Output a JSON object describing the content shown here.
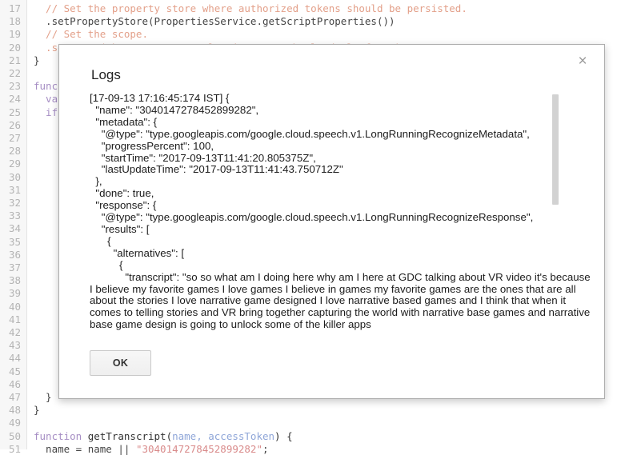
{
  "editor": {
    "first_line_number": 17,
    "lines": [
      {
        "n": 17,
        "segments": [
          {
            "t": "  // Set the property store where authorized tokens should be persisted.",
            "c": "tok-comment"
          }
        ]
      },
      {
        "n": 18,
        "segments": [
          {
            "t": "  .setPropertyStore(PropertiesService.getScriptProperties())",
            "c": "tok-plain"
          }
        ]
      },
      {
        "n": 19,
        "segments": [
          {
            "t": "  // Set the scope.",
            "c": "tok-comment"
          }
        ]
      },
      {
        "n": 20,
        "segments": [
          {
            "t": "  .setScope('https://www.googleapis.com/auth/cloud-platform');",
            "c": "tok-comment"
          }
        ]
      },
      {
        "n": 21,
        "segments": [
          {
            "t": "}",
            "c": "tok-plain"
          }
        ]
      },
      {
        "n": 22,
        "segments": [
          {
            "t": "",
            "c": "tok-plain"
          }
        ]
      },
      {
        "n": 23,
        "segments": [
          {
            "t": "func",
            "c": "tok-kw"
          }
        ]
      },
      {
        "n": 24,
        "segments": [
          {
            "t": "  va",
            "c": "tok-kw"
          }
        ]
      },
      {
        "n": 25,
        "segments": [
          {
            "t": "  if",
            "c": "tok-kw"
          }
        ]
      },
      {
        "n": 26,
        "segments": []
      },
      {
        "n": 27,
        "segments": []
      },
      {
        "n": 28,
        "segments": []
      },
      {
        "n": 29,
        "segments": []
      },
      {
        "n": 30,
        "segments": []
      },
      {
        "n": 31,
        "segments": []
      },
      {
        "n": 32,
        "segments": []
      },
      {
        "n": 33,
        "segments": []
      },
      {
        "n": 34,
        "segments": []
      },
      {
        "n": 35,
        "segments": []
      },
      {
        "n": 36,
        "segments": []
      },
      {
        "n": 37,
        "segments": []
      },
      {
        "n": 38,
        "segments": []
      },
      {
        "n": 39,
        "segments": []
      },
      {
        "n": 40,
        "segments": []
      },
      {
        "n": 41,
        "segments": []
      },
      {
        "n": 42,
        "segments": []
      },
      {
        "n": 43,
        "segments": []
      },
      {
        "n": 44,
        "segments": []
      },
      {
        "n": 45,
        "segments": []
      },
      {
        "n": 46,
        "segments": []
      },
      {
        "n": 47,
        "segments": [
          {
            "t": "  }",
            "c": "tok-plain"
          }
        ]
      },
      {
        "n": 48,
        "segments": [
          {
            "t": "}",
            "c": "tok-plain"
          }
        ]
      },
      {
        "n": 49,
        "segments": [
          {
            "t": "",
            "c": "tok-plain"
          }
        ]
      },
      {
        "n": 50,
        "segments": [
          {
            "t": "function ",
            "c": "tok-kw"
          },
          {
            "t": "getTranscript(",
            "c": "tok-fn"
          },
          {
            "t": "name, accessToken",
            "c": "tok-param"
          },
          {
            "t": ") {",
            "c": "tok-fn"
          }
        ]
      },
      {
        "n": 51,
        "segments": [
          {
            "t": "  name = name || ",
            "c": "tok-plain"
          },
          {
            "t": "\"3040147278452899282\"",
            "c": "tok-str"
          },
          {
            "t": ";",
            "c": "tok-plain"
          }
        ]
      }
    ]
  },
  "dialog": {
    "title": "Logs",
    "close_label": "×",
    "ok_label": "OK",
    "log_text": "[17-09-13 17:16:45:174 IST] {\n  \"name\": \"3040147278452899282\",\n  \"metadata\": {\n    \"@type\": \"type.googleapis.com/google.cloud.speech.v1.LongRunningRecognizeMetadata\",\n    \"progressPercent\": 100,\n    \"startTime\": \"2017-09-13T11:41:20.805375Z\",\n    \"lastUpdateTime\": \"2017-09-13T11:41:43.750712Z\"\n  },\n  \"done\": true,\n  \"response\": {\n    \"@type\": \"type.googleapis.com/google.cloud.speech.v1.LongRunningRecognizeResponse\",\n    \"results\": [\n      {\n        \"alternatives\": [\n          {\n            \"transcript\": \"so so what am I doing here why am I here at GDC talking about VR video it's because I believe my favorite games I love games I believe in games my favorite games are the ones that are all about the stories I love narrative game designed I love narrative based games and I think that when it comes to telling stories and VR bring together capturing the world with narrative base games and narrative base game design is going to unlock some of the killer apps"
  },
  "colors": {
    "dialog_border": "#acacac",
    "scrollbar_thumb": "#d2d2d2",
    "gutter_bg": "#f7f7f7",
    "comment": "#e3a08a",
    "keyword": "#a68ec4",
    "string": "#d98b8b",
    "param": "#8fa6d8"
  }
}
